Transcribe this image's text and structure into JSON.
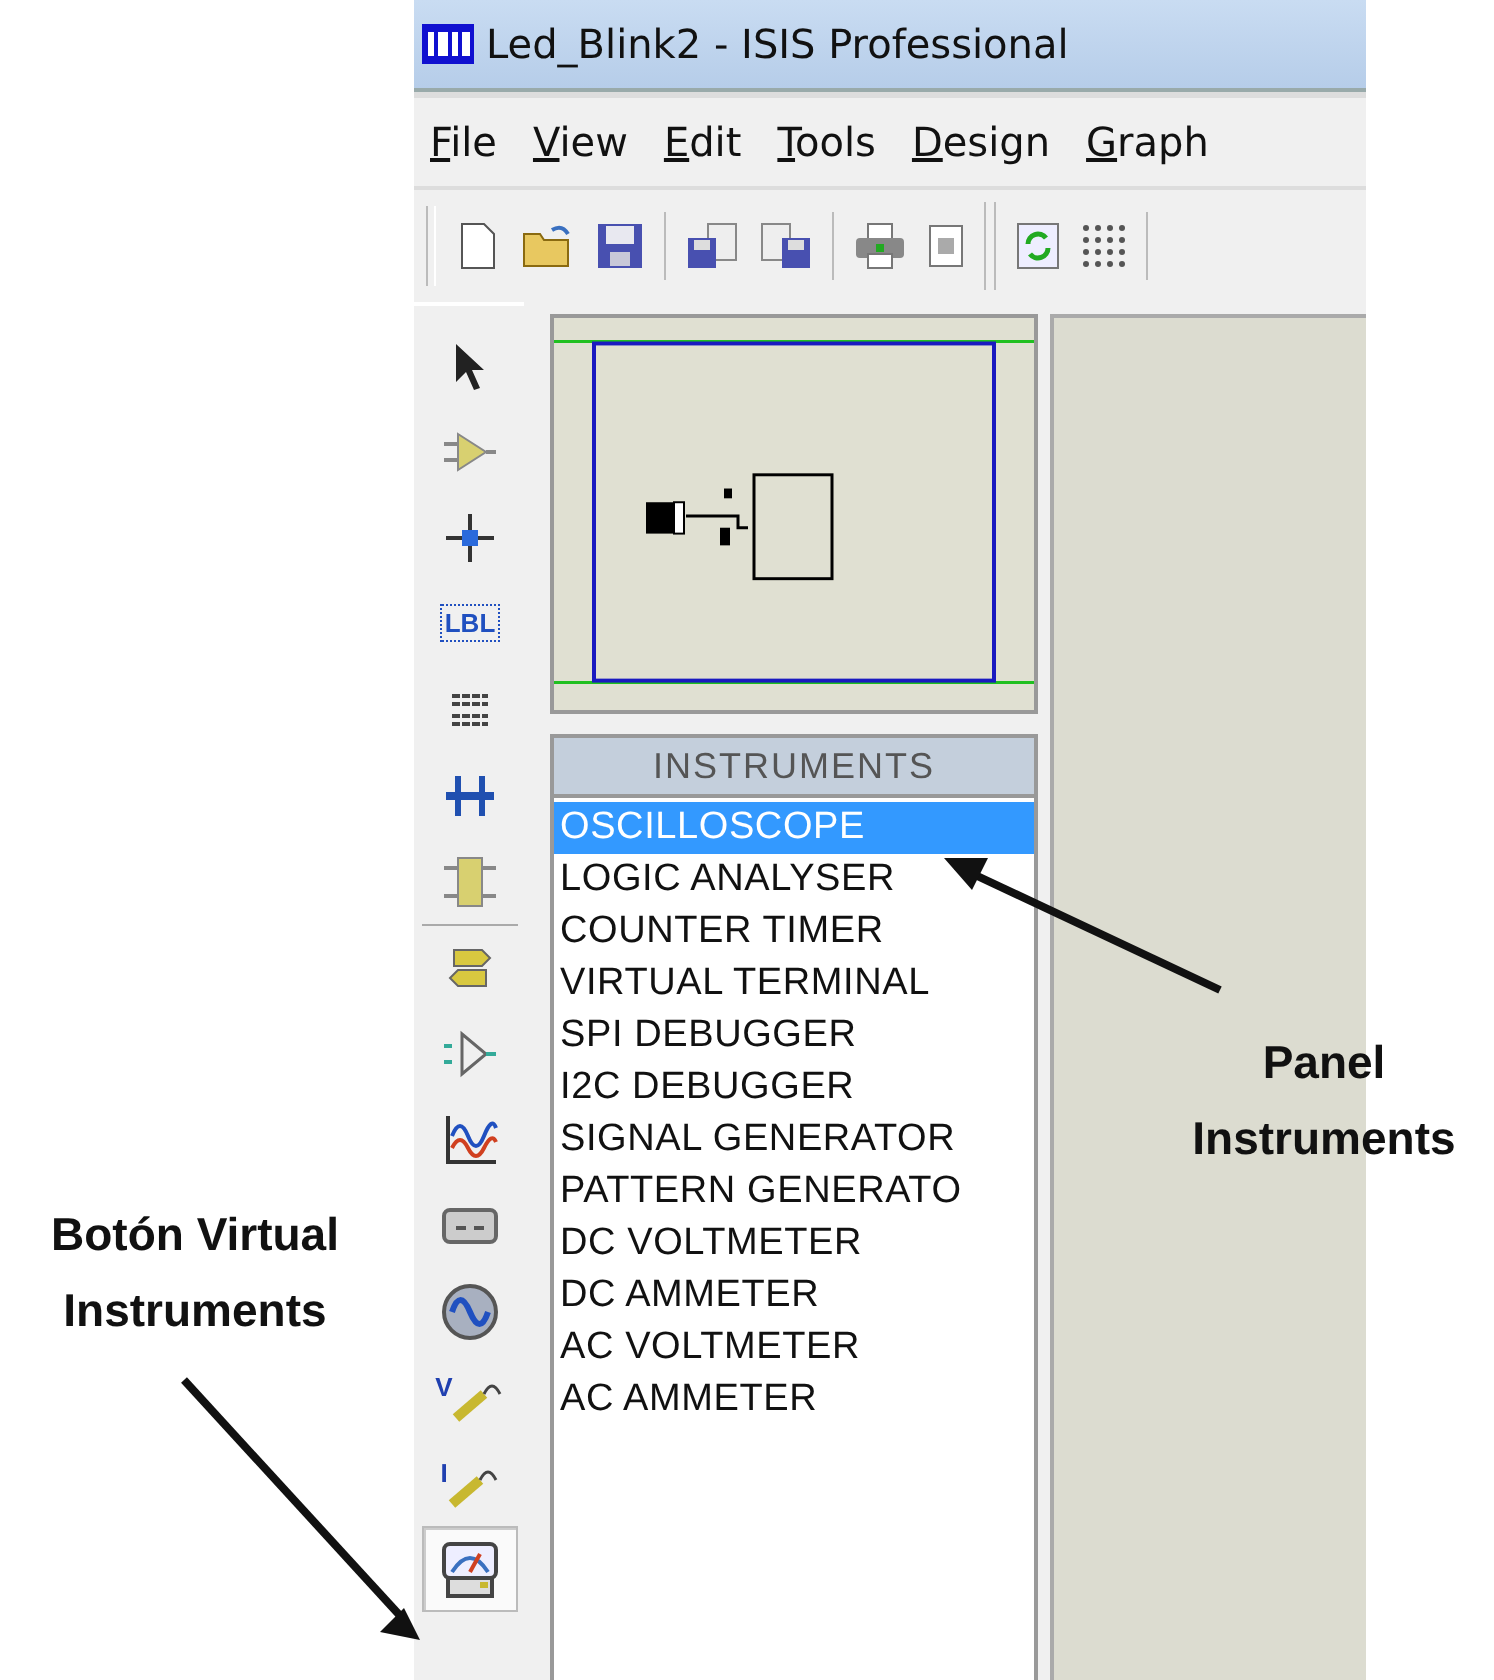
{
  "window": {
    "title": "Led_Blink2 - ISIS Professional"
  },
  "menu": [
    "File",
    "View",
    "Edit",
    "Tools",
    "Design",
    "Graph"
  ],
  "tools": [
    {
      "kind": "select",
      "selected": false
    },
    {
      "kind": "component",
      "selected": false
    },
    {
      "kind": "junction",
      "selected": false
    },
    {
      "kind": "label",
      "label": "LBL",
      "selected": false
    },
    {
      "kind": "script",
      "selected": false
    },
    {
      "kind": "bus",
      "selected": false
    },
    {
      "kind": "subcircuit",
      "selected": false
    },
    {
      "kind": "terminal",
      "selected": false
    },
    {
      "kind": "pin",
      "selected": false
    },
    {
      "kind": "graph",
      "selected": false
    },
    {
      "kind": "tape",
      "selected": false
    },
    {
      "kind": "generator",
      "selected": false
    },
    {
      "kind": "probe",
      "label": "V",
      "selected": false
    },
    {
      "kind": "probe",
      "label": "I",
      "selected": false
    },
    {
      "kind": "instrument",
      "selected": true
    }
  ],
  "instruments": {
    "title": "INSTRUMENTS",
    "items": [
      {
        "label": "OSCILLOSCOPE",
        "selected": true
      },
      {
        "label": "LOGIC ANALYSER",
        "selected": false
      },
      {
        "label": "COUNTER TIMER",
        "selected": false
      },
      {
        "label": "VIRTUAL TERMINAL",
        "selected": false
      },
      {
        "label": "SPI DEBUGGER",
        "selected": false
      },
      {
        "label": "I2C DEBUGGER",
        "selected": false
      },
      {
        "label": "SIGNAL GENERATOR",
        "selected": false
      },
      {
        "label": "PATTERN GENERATO",
        "selected": false
      },
      {
        "label": "DC VOLTMETER",
        "selected": false
      },
      {
        "label": "DC AMMETER",
        "selected": false
      },
      {
        "label": "AC VOLTMETER",
        "selected": false
      },
      {
        "label": "AC AMMETER",
        "selected": false
      }
    ]
  },
  "annotations": [
    {
      "kind": "panel",
      "text": "Panel Instruments"
    },
    {
      "kind": "button",
      "text": "Botón Virtual Instruments"
    }
  ]
}
